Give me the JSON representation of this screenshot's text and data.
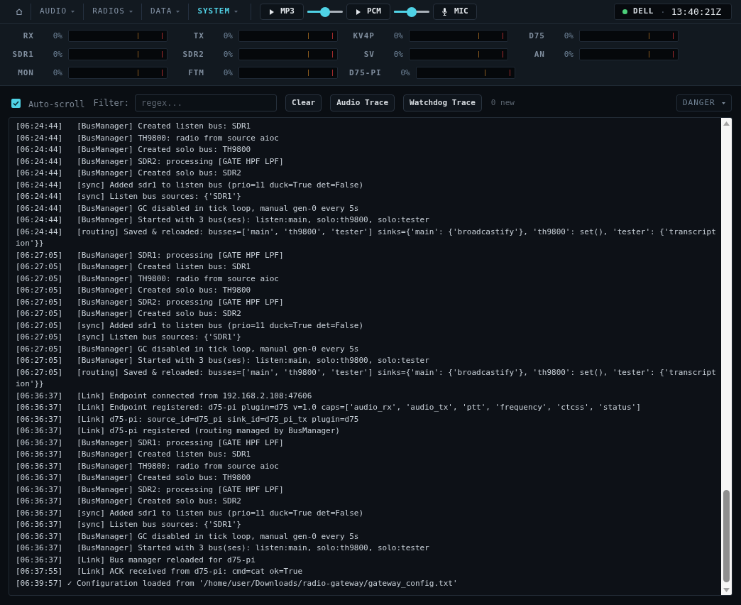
{
  "nav": {
    "tabs": [
      {
        "label": "AUDIO",
        "selected": false
      },
      {
        "label": "RADIOS",
        "selected": false
      },
      {
        "label": "DATA",
        "selected": false
      },
      {
        "label": "SYSTEM",
        "selected": true
      }
    ]
  },
  "audio_buttons": [
    {
      "kind": "play",
      "label": "MP3",
      "slider": {
        "level": 0.5
      }
    },
    {
      "kind": "play",
      "label": "PCM",
      "slider": {
        "level": 0.5
      }
    },
    {
      "kind": "mic",
      "label": "MIC"
    }
  ],
  "status": {
    "online": true,
    "host": "DELL",
    "separator": "·",
    "clock": "13:40:21Z"
  },
  "meter_rows": [
    {
      "meters": [
        {
          "label": "RX",
          "reading": "0%"
        },
        {
          "label": "TX",
          "reading": "0%"
        },
        {
          "label": "KV4P",
          "reading": "0%"
        },
        {
          "label": "D75",
          "reading": "0%"
        }
      ]
    },
    {
      "meters": [
        {
          "label": "SDR1",
          "reading": "0%"
        },
        {
          "label": "SDR2",
          "reading": "0%"
        },
        {
          "label": "SV",
          "reading": "0%"
        },
        {
          "label": "AN",
          "reading": "0%"
        }
      ]
    },
    {
      "meters": [
        {
          "label": "MON",
          "reading": "0%"
        },
        {
          "label": "FTM",
          "reading": "0%"
        },
        {
          "label": "D75-PI",
          "reading": "0%"
        }
      ]
    }
  ],
  "toolbar": {
    "auto_scroll": {
      "label": "Auto-scroll",
      "checked": true
    },
    "filter": {
      "label": "Filter:",
      "placeholder": "regex..."
    },
    "buttons": [
      "Clear",
      "Audio Trace",
      "Watchdog Trace"
    ],
    "new_count": "0 new",
    "severity_select": {
      "value": "DANGER"
    }
  },
  "log": {
    "lines": [
      {
        "kind": "entry",
        "time": "[06:24:44]",
        "text": "[BusManager] Created listen bus: SDR1"
      },
      {
        "kind": "entry",
        "time": "[06:24:44]",
        "text": "[BusManager] TH9800: radio from source aioc"
      },
      {
        "kind": "entry",
        "time": "[06:24:44]",
        "text": "[BusManager] Created solo bus: TH9800"
      },
      {
        "kind": "entry",
        "time": "[06:24:44]",
        "text": "[BusManager] SDR2: processing [GATE HPF LPF]"
      },
      {
        "kind": "entry",
        "time": "[06:24:44]",
        "text": "[BusManager] Created solo bus: SDR2"
      },
      {
        "kind": "entry",
        "time": "[06:24:44]",
        "text": "[sync] Added sdr1 to listen bus (prio=11 duck=True det=False)"
      },
      {
        "kind": "entry",
        "time": "[06:24:44]",
        "text": "[sync] Listen bus sources: {'SDR1'}"
      },
      {
        "kind": "entry",
        "time": "[06:24:44]",
        "text": "[BusManager] GC disabled in tick loop, manual gen-0 every 5s"
      },
      {
        "kind": "entry",
        "time": "[06:24:44]",
        "text": "[BusManager] Started with 3 bus(ses): listen:main, solo:th9800, solo:tester"
      },
      {
        "kind": "entry",
        "time": "[06:24:44]",
        "text": "[routing] Saved & reloaded: busses=['main', 'th9800', 'tester'] sinks={'main': {'broadcastify'}, 'th9800': set(), 'tester': {'transcription'}}"
      },
      {
        "kind": "entry",
        "time": "[06:27:05]",
        "text": "[BusManager] SDR1: processing [GATE HPF LPF]"
      },
      {
        "kind": "entry",
        "time": "[06:27:05]",
        "text": "[BusManager] Created listen bus: SDR1"
      },
      {
        "kind": "entry",
        "time": "[06:27:05]",
        "text": "[BusManager] TH9800: radio from source aioc"
      },
      {
        "kind": "entry",
        "time": "[06:27:05]",
        "text": "[BusManager] Created solo bus: TH9800"
      },
      {
        "kind": "entry",
        "time": "[06:27:05]",
        "text": "[BusManager] SDR2: processing [GATE HPF LPF]"
      },
      {
        "kind": "entry",
        "time": "[06:27:05]",
        "text": "[BusManager] Created solo bus: SDR2"
      },
      {
        "kind": "entry",
        "time": "[06:27:05]",
        "text": "[sync] Added sdr1 to listen bus (prio=11 duck=True det=False)"
      },
      {
        "kind": "entry",
        "time": "[06:27:05]",
        "text": "[sync] Listen bus sources: {'SDR1'}"
      },
      {
        "kind": "entry",
        "time": "[06:27:05]",
        "text": "[BusManager] GC disabled in tick loop, manual gen-0 every 5s"
      },
      {
        "kind": "entry",
        "time": "[06:27:05]",
        "text": "[BusManager] Started with 3 bus(ses): listen:main, solo:th9800, solo:tester"
      },
      {
        "kind": "entry",
        "time": "[06:27:05]",
        "text": "[routing] Saved & reloaded: busses=['main', 'th9800', 'tester'] sinks={'main': {'broadcastify'}, 'th9800': set(), 'tester': {'transcription'}}"
      },
      {
        "kind": "entry",
        "time": "[06:36:37]",
        "text": "[Link] Endpoint connected from 192.168.2.108:47606"
      },
      {
        "kind": "entry",
        "time": "[06:36:37]",
        "text": "[Link] Endpoint registered: d75-pi plugin=d75 v=1.0 caps=['audio_rx', 'audio_tx', 'ptt', 'frequency', 'ctcss', 'status']"
      },
      {
        "kind": "entry",
        "time": "[06:36:37]",
        "text": "[Link] d75-pi: source_id=d75_pi sink_id=d75_pi_tx plugin=d75"
      },
      {
        "kind": "entry",
        "time": "[06:36:37]",
        "text": "[Link] d75-pi registered (routing managed by BusManager)"
      },
      {
        "kind": "entry",
        "time": "[06:36:37]",
        "text": "[BusManager] SDR1: processing [GATE HPF LPF]"
      },
      {
        "kind": "entry",
        "time": "[06:36:37]",
        "text": "[BusManager] Created listen bus: SDR1"
      },
      {
        "kind": "entry",
        "time": "[06:36:37]",
        "text": "[BusManager] TH9800: radio from source aioc"
      },
      {
        "kind": "entry",
        "time": "[06:36:37]",
        "text": "[BusManager] Created solo bus: TH9800"
      },
      {
        "kind": "entry",
        "time": "[06:36:37]",
        "text": "[BusManager] SDR2: processing [GATE HPF LPF]"
      },
      {
        "kind": "entry",
        "time": "[06:36:37]",
        "text": "[BusManager] Created solo bus: SDR2"
      },
      {
        "kind": "entry",
        "time": "[06:36:37]",
        "text": "[sync] Added sdr1 to listen bus (prio=11 duck=True det=False)"
      },
      {
        "kind": "entry",
        "time": "[06:36:37]",
        "text": "[sync] Listen bus sources: {'SDR1'}"
      },
      {
        "kind": "entry",
        "time": "[06:36:37]",
        "text": "[BusManager] GC disabled in tick loop, manual gen-0 every 5s"
      },
      {
        "kind": "entry",
        "time": "[06:36:37]",
        "text": "[BusManager] Started with 3 bus(ses): listen:main, solo:th9800, solo:tester"
      },
      {
        "kind": "entry",
        "time": "[06:36:37]",
        "text": "[Link] Bus manager reloaded for d75-pi"
      },
      {
        "kind": "entry",
        "time": "[06:37:55]",
        "text": "[Link] ACK received from d75-pi: cmd=cat ok=True"
      },
      {
        "kind": "notice",
        "time": "[06:39:57]",
        "text": "✓ Configuration loaded from '/home/user/Downloads/radio-gateway/gateway_config.txt'"
      }
    ]
  }
}
